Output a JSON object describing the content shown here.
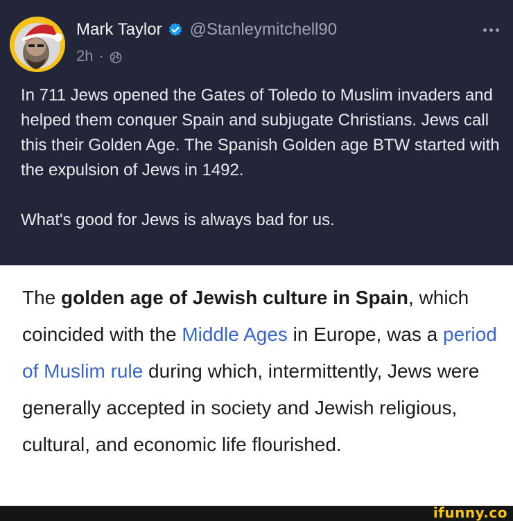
{
  "tweet": {
    "author": {
      "display_name": "Mark Taylor",
      "handle": "@Stanleymitchell90",
      "verified": true,
      "avatar_icon": "santa-hat-avatar"
    },
    "meta": {
      "time": "2h",
      "separator": "·",
      "audience_icon": "globe-icon"
    },
    "more_icon": "more-horizontal-icon",
    "text": {
      "paragraph_1": "In 711 Jews opened the Gates of Toledo to Muslim invaders and helped them conquer Spain and subjugate Christians. Jews call this their Golden Age. The Spanish Golden age BTW started with the expulsion of Jews in 1492.",
      "paragraph_2": "What's good for Jews is always bad for us."
    }
  },
  "quote": {
    "intro": "The ",
    "bold": "golden age of Jewish culture in Spain",
    "part_2": ", which coincided with the ",
    "link_1": "Middle Ages",
    "part_3": " in Europe, was a ",
    "link_2": "period of Muslim rule",
    "part_4": " during which, intermittently, Jews were generally accepted in society and Jewish religious, cultural, and economic life flourished."
  },
  "watermark": "ifunny.co",
  "colors": {
    "tweet_bg": "#232638",
    "link": "#3b66c0",
    "verified": "#1d9bf0",
    "watermark": "#f7c61d"
  }
}
